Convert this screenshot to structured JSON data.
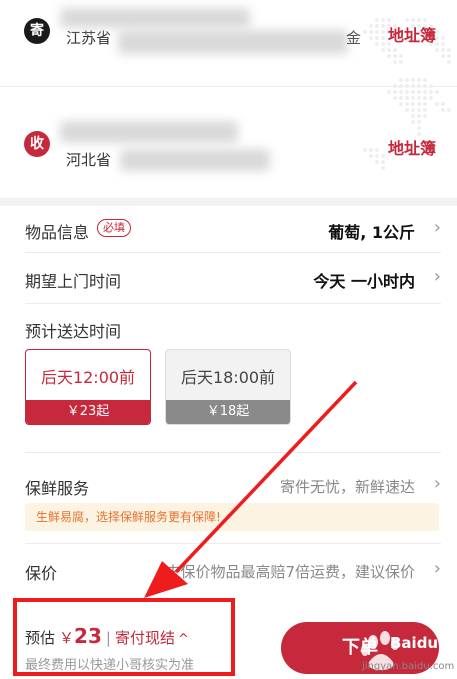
{
  "sender": {
    "badge": "寄",
    "address_prefix": "江苏省",
    "address_tail": "金",
    "address_book": "地址簿"
  },
  "receiver": {
    "badge": "收",
    "address_prefix": "河北省",
    "address_book": "地址簿"
  },
  "item_info": {
    "label": "物品信息",
    "required_tag": "必填",
    "value": "葡萄, 1公斤"
  },
  "pickup_time": {
    "label": "期望上门时间",
    "value": "今天 一小时内"
  },
  "delivery": {
    "label": "预计送达时间",
    "options": [
      {
        "time": "后天12:00前",
        "price": "￥23起",
        "selected": true
      },
      {
        "time": "后天18:00前",
        "price": "￥18起",
        "selected": false
      }
    ]
  },
  "fresh_service": {
    "label": "保鲜服务",
    "note": "寄件无忧，新鲜速达",
    "tip": "生鲜易腐，选择保鲜服务更有保障!"
  },
  "insurance": {
    "label": "保价",
    "note": "未保价物品最高赔7倍运费，建议保价"
  },
  "footer": {
    "estimate_label": "预估",
    "currency": "￥",
    "amount": "23",
    "separator": "|",
    "payment_mode": "寄付现结",
    "caret": "^",
    "note": "最终费用以快递小哥核实为准",
    "submit_label": "下单"
  },
  "watermark": {
    "brand": "Baidu 经验",
    "url": "jingyan.baidu.com"
  },
  "colors": {
    "accent": "#c6283c",
    "annotation": "#ee1c1c",
    "tip_text": "#e8722c",
    "tip_bg": "#fdf3e3"
  }
}
